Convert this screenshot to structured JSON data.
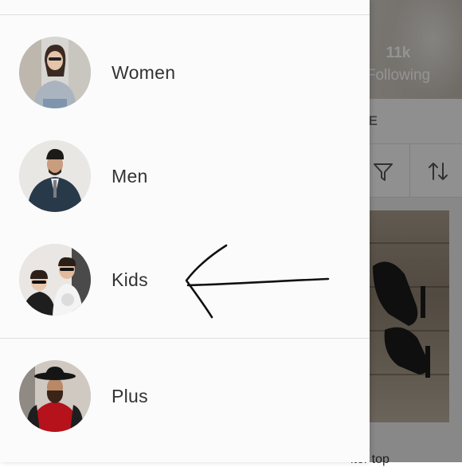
{
  "background": {
    "stats": {
      "count": "11k",
      "label": "Following"
    },
    "tab_label": "TIQUE",
    "toolbar_icons": [
      "filter-icon",
      "sort-icon"
    ],
    "product_caption": "lter top"
  },
  "drawer": {
    "categories": [
      {
        "label": "Women",
        "icon": "women-avatar"
      },
      {
        "label": "Men",
        "icon": "men-avatar"
      },
      {
        "label": "Kids",
        "icon": "kids-avatar"
      },
      {
        "label": "Plus",
        "icon": "plus-avatar"
      }
    ]
  },
  "annotation": {
    "icon": "hand-drawn-arrow-icon",
    "points_to": "Kids"
  },
  "colors": {
    "drawer_bg": "#fcfbfb",
    "text": "#333333",
    "divider": "#dedede",
    "overlay": "rgba(0,0,0,0.42)"
  }
}
